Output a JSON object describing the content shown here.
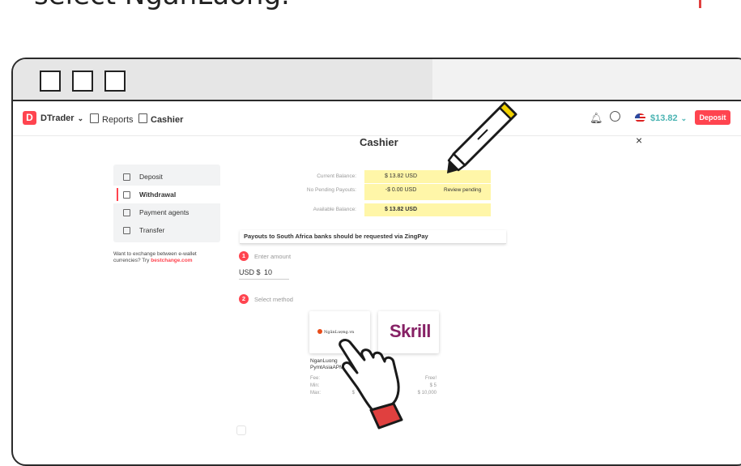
{
  "caption": "select NganLuong.",
  "navbar": {
    "app_name": "DTrader",
    "reports": "Reports",
    "cashier": "Cashier",
    "balance": "$13.82",
    "deposit": "Deposit"
  },
  "cashier": {
    "title": "Cashier",
    "close": "×"
  },
  "sidebar": {
    "items": [
      {
        "label": "Deposit"
      },
      {
        "label": "Withdrawal"
      },
      {
        "label": "Payment agents"
      },
      {
        "label": "Transfer"
      }
    ],
    "exchange_text": "Want to exchange between e-wallet currencies? Try ",
    "exchange_link": "bestchange.com"
  },
  "balances": {
    "current_label": "Current Balance:",
    "current_value": "$ 13.82 USD",
    "pending_label": "No Pending Payouts:",
    "pending_value": "-$ 0.00 USD",
    "review_pending": "Review pending",
    "available_label": "Available Balance:",
    "available_value": "$ 13.82 USD"
  },
  "notice": "Payouts to South Africa banks should be requested via ZingPay",
  "step1": {
    "number": "1",
    "label": "Enter amount",
    "currency": "USD $",
    "value": "10"
  },
  "step2": {
    "number": "2",
    "label": "Select method"
  },
  "methods": {
    "nganluong_logo": "NgânLượng.vn",
    "skrill_logo": "Skrill",
    "nganluong_name": "NganLuong",
    "nganluong_sub": "PymtAsiaAPM",
    "skrill_partial": "a",
    "fee_label": "Fee:",
    "min_label": "Min:",
    "max_label": "Max:",
    "nl_max_partial": "$",
    "skrill_fee": "Free!",
    "skrill_min": "$ 5",
    "skrill_max": "$ 10,000"
  },
  "colors": {
    "brand_red": "#ff444f",
    "highlight_yellow": "#fff6a8",
    "balance_teal": "#4bb4b3",
    "skrill_purple": "#862165"
  }
}
